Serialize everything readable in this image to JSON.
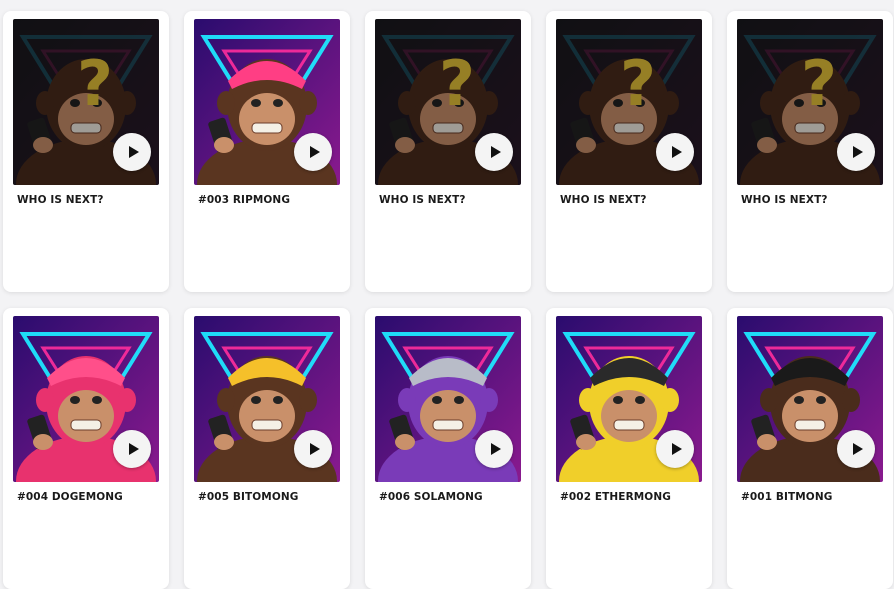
{
  "cards": [
    {
      "name": "WHO IS NEXT?",
      "mystery": true,
      "fur": "#4a2c1c",
      "bg1": "#1a1a1e",
      "bg2": "#2a1a2a",
      "neon1": "#1e6f84",
      "neon2": "#7a1e52",
      "accent": "#e6c43a"
    },
    {
      "name": "#003 RIPMONG",
      "mystery": false,
      "fur": "#5a3520",
      "bg1": "#2a0c6e",
      "bg2": "#8a1a8e",
      "neon1": "#1ee7ff",
      "neon2": "#ff2e9c",
      "accent": "#ff3e84"
    },
    {
      "name": "WHO IS NEXT?",
      "mystery": true,
      "fur": "#4a2c1c",
      "bg1": "#1a1a1e",
      "bg2": "#2a1a2a",
      "neon1": "#1e6f84",
      "neon2": "#7a1e52",
      "accent": "#e6c43a"
    },
    {
      "name": "WHO IS NEXT?",
      "mystery": true,
      "fur": "#4a2c1c",
      "bg1": "#1a1a1e",
      "bg2": "#2a1a2a",
      "neon1": "#1e6f84",
      "neon2": "#7a1e52",
      "accent": "#e6c43a"
    },
    {
      "name": "WHO IS NEXT?",
      "mystery": true,
      "fur": "#4a2c1c",
      "bg1": "#1a1a1e",
      "bg2": "#2a1a2a",
      "neon1": "#1e6f84",
      "neon2": "#7a1e52",
      "accent": "#e6c43a"
    },
    {
      "name": "#004 DOGEMONG",
      "mystery": false,
      "fur": "#e8326e",
      "bg1": "#2a0c6e",
      "bg2": "#8a1a8e",
      "neon1": "#1ee7ff",
      "neon2": "#ff2e9c",
      "accent": "#ff4f8a"
    },
    {
      "name": "#005 BITOMONG",
      "mystery": false,
      "fur": "#5a3520",
      "bg1": "#2a0c6e",
      "bg2": "#8a1a8e",
      "neon1": "#1ee7ff",
      "neon2": "#ff2e9c",
      "accent": "#f5c02a"
    },
    {
      "name": "#006 SOLAMONG",
      "mystery": false,
      "fur": "#7a3bb8",
      "bg1": "#2a0c6e",
      "bg2": "#8a1a8e",
      "neon1": "#1ee7ff",
      "neon2": "#ff2e9c",
      "accent": "#b8bcc8"
    },
    {
      "name": "#002 ETHERMONG",
      "mystery": false,
      "fur": "#f0cf2a",
      "bg1": "#2a0c6e",
      "bg2": "#8a1a8e",
      "neon1": "#1ee7ff",
      "neon2": "#ff2e9c",
      "accent": "#2a2a2a"
    },
    {
      "name": "#001 BITMONG",
      "mystery": false,
      "fur": "#4a2c1c",
      "bg1": "#2a0c6e",
      "bg2": "#8a1a8e",
      "neon1": "#1ee7ff",
      "neon2": "#ff2e9c",
      "accent": "#1a1a1a"
    }
  ]
}
